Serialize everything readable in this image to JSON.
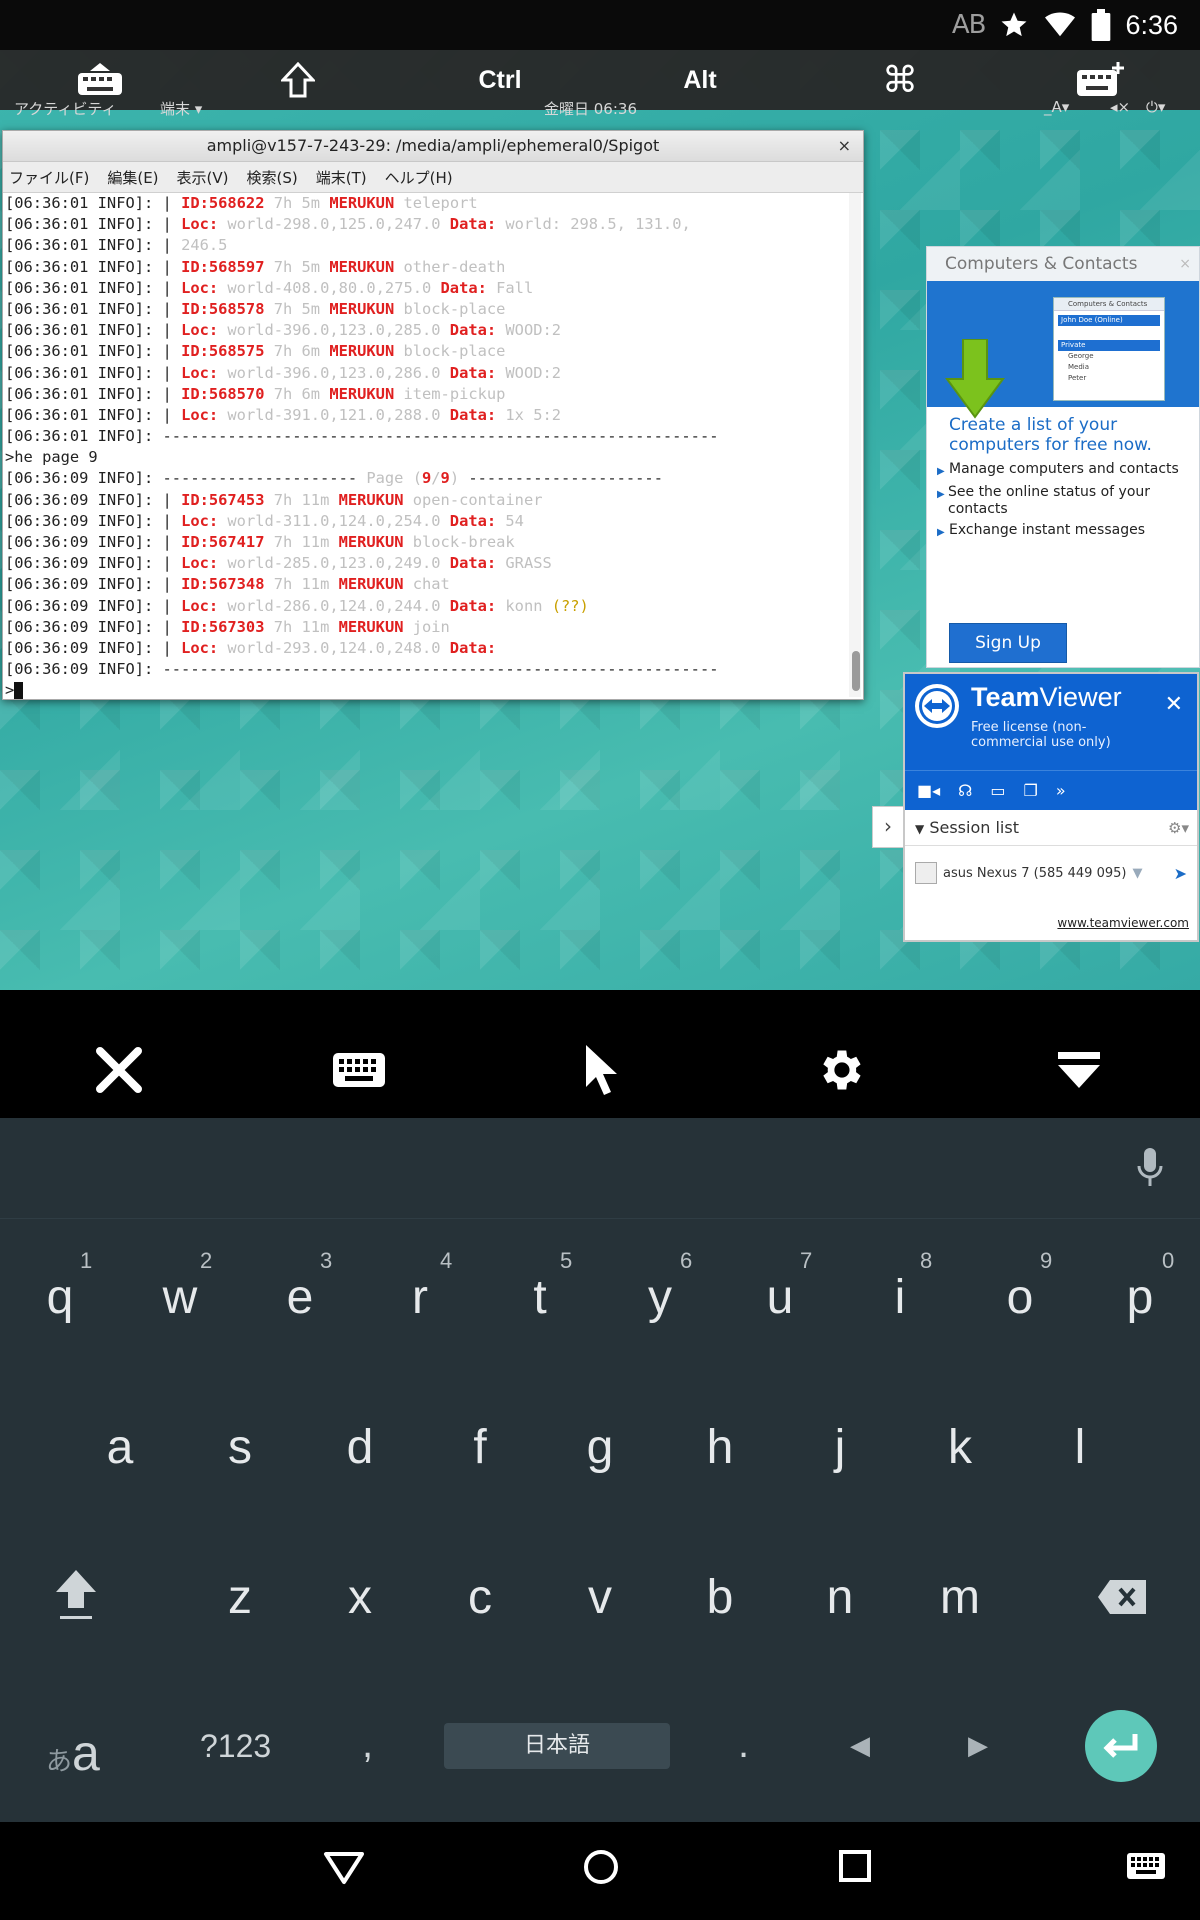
{
  "status_bar": {
    "ab_label": "AB",
    "time": "6:36",
    "icons": [
      "star-icon",
      "wifi-icon",
      "battery-icon"
    ]
  },
  "extra_keys": {
    "ctrl": "Ctrl",
    "alt": "Alt",
    "cmd_symbol": "⌘"
  },
  "gnome_bar": {
    "activities": "アクティビティ",
    "app_menu": "端末 ▾",
    "clock": "金曜日 06:36",
    "lang": "_A▾"
  },
  "terminal": {
    "title": "ampli@v157-7-243-29: /media/ampli/ephemeral0/Spigot",
    "close": "×",
    "menu": [
      "ファイル(F)",
      "編集(E)",
      "表示(V)",
      "検索(S)",
      "端末(T)",
      "ヘルプ(H)"
    ],
    "prompt": ">"
  },
  "log": [
    [
      [
        "[06:36:01 INFO]: | ",
        ""
      ],
      [
        "ID:568622",
        "red"
      ],
      [
        " 7h 5m ",
        "grey"
      ],
      [
        "MERUKUN",
        "red"
      ],
      [
        " teleport",
        "grey"
      ]
    ],
    [
      [
        "[06:36:01 INFO]: | ",
        ""
      ],
      [
        "Loc:",
        "red"
      ],
      [
        " world-298.0,125.0,247.0 ",
        "grey"
      ],
      [
        "Data:",
        "red"
      ],
      [
        " world: 298.5, 131.0,",
        "grey"
      ]
    ],
    [
      [
        "[06:36:01 INFO]: | ",
        ""
      ],
      [
        "246.5",
        "grey"
      ]
    ],
    [
      [
        "[06:36:01 INFO]: | ",
        ""
      ],
      [
        "ID:568597",
        "red"
      ],
      [
        " 7h 5m ",
        "grey"
      ],
      [
        "MERUKUN",
        "red"
      ],
      [
        " other-death",
        "grey"
      ]
    ],
    [
      [
        "[06:36:01 INFO]: | ",
        ""
      ],
      [
        "Loc:",
        "red"
      ],
      [
        " world-408.0,80.0,275.0 ",
        "grey"
      ],
      [
        "Data:",
        "red"
      ],
      [
        " Fall",
        "grey"
      ]
    ],
    [
      [
        "[06:36:01 INFO]: | ",
        ""
      ],
      [
        "ID:568578",
        "red"
      ],
      [
        " 7h 5m ",
        "grey"
      ],
      [
        "MERUKUN",
        "red"
      ],
      [
        " block-place",
        "grey"
      ]
    ],
    [
      [
        "[06:36:01 INFO]: | ",
        ""
      ],
      [
        "Loc:",
        "red"
      ],
      [
        " world-396.0,123.0,285.0 ",
        "grey"
      ],
      [
        "Data:",
        "red"
      ],
      [
        " WOOD:2",
        "grey"
      ]
    ],
    [
      [
        "[06:36:01 INFO]: | ",
        ""
      ],
      [
        "ID:568575",
        "red"
      ],
      [
        " 7h 6m ",
        "grey"
      ],
      [
        "MERUKUN",
        "red"
      ],
      [
        " block-place",
        "grey"
      ]
    ],
    [
      [
        "[06:36:01 INFO]: | ",
        ""
      ],
      [
        "Loc:",
        "red"
      ],
      [
        " world-396.0,123.0,286.0 ",
        "grey"
      ],
      [
        "Data:",
        "red"
      ],
      [
        " WOOD:2",
        "grey"
      ]
    ],
    [
      [
        "[06:36:01 INFO]: | ",
        ""
      ],
      [
        "ID:568570",
        "red"
      ],
      [
        " 7h 6m ",
        "grey"
      ],
      [
        "MERUKUN",
        "red"
      ],
      [
        " item-pickup",
        "grey"
      ]
    ],
    [
      [
        "[06:36:01 INFO]: | ",
        ""
      ],
      [
        "Loc:",
        "red"
      ],
      [
        " world-391.0,121.0,288.0 ",
        "grey"
      ],
      [
        "Data:",
        "red"
      ],
      [
        " 1x 5:2",
        "grey"
      ]
    ],
    [
      [
        "[06:36:01 INFO]: ------------------------------------------------------------",
        ""
      ]
    ],
    [
      [
        ">he page 9",
        ""
      ]
    ],
    [
      [
        "[06:36:09 INFO]: --------------------- ",
        ""
      ],
      [
        "Page (",
        "grey"
      ],
      [
        "9",
        "red"
      ],
      [
        "/",
        "grey"
      ],
      [
        "9",
        "red"
      ],
      [
        ")",
        "grey"
      ],
      [
        " ---------------------",
        ""
      ]
    ],
    [
      [
        "[06:36:09 INFO]: | ",
        ""
      ],
      [
        "ID:567453",
        "red"
      ],
      [
        " 7h 11m ",
        "grey"
      ],
      [
        "MERUKUN",
        "red"
      ],
      [
        " open-container",
        "grey"
      ]
    ],
    [
      [
        "[06:36:09 INFO]: | ",
        ""
      ],
      [
        "Loc:",
        "red"
      ],
      [
        " world-311.0,124.0,254.0 ",
        "grey"
      ],
      [
        "Data:",
        "red"
      ],
      [
        " 54",
        "grey"
      ]
    ],
    [
      [
        "[06:36:09 INFO]: | ",
        ""
      ],
      [
        "ID:567417",
        "red"
      ],
      [
        " 7h 11m ",
        "grey"
      ],
      [
        "MERUKUN",
        "red"
      ],
      [
        " block-break",
        "grey"
      ]
    ],
    [
      [
        "[06:36:09 INFO]: | ",
        ""
      ],
      [
        "Loc:",
        "red"
      ],
      [
        " world-285.0,123.0,249.0 ",
        "grey"
      ],
      [
        "Data:",
        "red"
      ],
      [
        " GRASS",
        "grey"
      ]
    ],
    [
      [
        "[06:36:09 INFO]: | ",
        ""
      ],
      [
        "ID:567348",
        "red"
      ],
      [
        " 7h 11m ",
        "grey"
      ],
      [
        "MERUKUN",
        "red"
      ],
      [
        " chat",
        "grey"
      ]
    ],
    [
      [
        "[06:36:09 INFO]: | ",
        ""
      ],
      [
        "Loc:",
        "red"
      ],
      [
        " world-286.0,124.0,244.0 ",
        "grey"
      ],
      [
        "Data:",
        "red"
      ],
      [
        " konn ",
        "grey"
      ],
      [
        "(??)",
        "gold"
      ]
    ],
    [
      [
        "[06:36:09 INFO]: | ",
        ""
      ],
      [
        "ID:567303",
        "red"
      ],
      [
        " 7h 11m ",
        "grey"
      ],
      [
        "MERUKUN",
        "red"
      ],
      [
        " join",
        "grey"
      ]
    ],
    [
      [
        "[06:36:09 INFO]: | ",
        ""
      ],
      [
        "Loc:",
        "red"
      ],
      [
        " world-293.0,124.0,248.0 ",
        "grey"
      ],
      [
        "Data:",
        "red"
      ]
    ],
    [
      [
        "[06:36:09 INFO]: ------------------------------------------------------------",
        ""
      ]
    ]
  ],
  "ad": {
    "header": "Computers & Contacts",
    "close": "×",
    "mini_title": "Computers & Contacts",
    "mini_user": "John Doe (Online)",
    "mini_group": "Private",
    "mini_items": [
      "George",
      "Media",
      "Peter"
    ],
    "headline": "Create a list of your computers for free now.",
    "bullets": [
      "Manage computers and contacts",
      "See the online status of your contacts",
      "Exchange instant messages"
    ],
    "signup": "Sign Up"
  },
  "teamviewer": {
    "name_bold": "Team",
    "name_rest": "Viewer",
    "subtitle": "Free license (non-commercial use only)",
    "close": "✕",
    "session_list": "Session list",
    "device": "asus Nexus 7 (585 449 095)",
    "link": "www.teamviewer.com",
    "tab_arrow": "›"
  },
  "keyboard": {
    "row1": [
      "q",
      "w",
      "e",
      "r",
      "t",
      "y",
      "u",
      "i",
      "o",
      "p"
    ],
    "row1_hints": [
      "1",
      "2",
      "3",
      "4",
      "5",
      "6",
      "7",
      "8",
      "9",
      "0"
    ],
    "row2": [
      "a",
      "s",
      "d",
      "f",
      "g",
      "h",
      "j",
      "k",
      "l"
    ],
    "row3": [
      "z",
      "x",
      "c",
      "v",
      "b",
      "n",
      "m"
    ],
    "lang_small": "あ",
    "lang_big": "a",
    "symbols": "?123",
    "comma": ",",
    "space_label": "日本語",
    "period": ".",
    "left": "◀",
    "right": "▶"
  },
  "colors": {
    "keyboard_bg": "#263238",
    "enter_accent": "#5ec8b9",
    "teamviewer_blue": "#0e63d1",
    "log_red": "#e02020"
  }
}
